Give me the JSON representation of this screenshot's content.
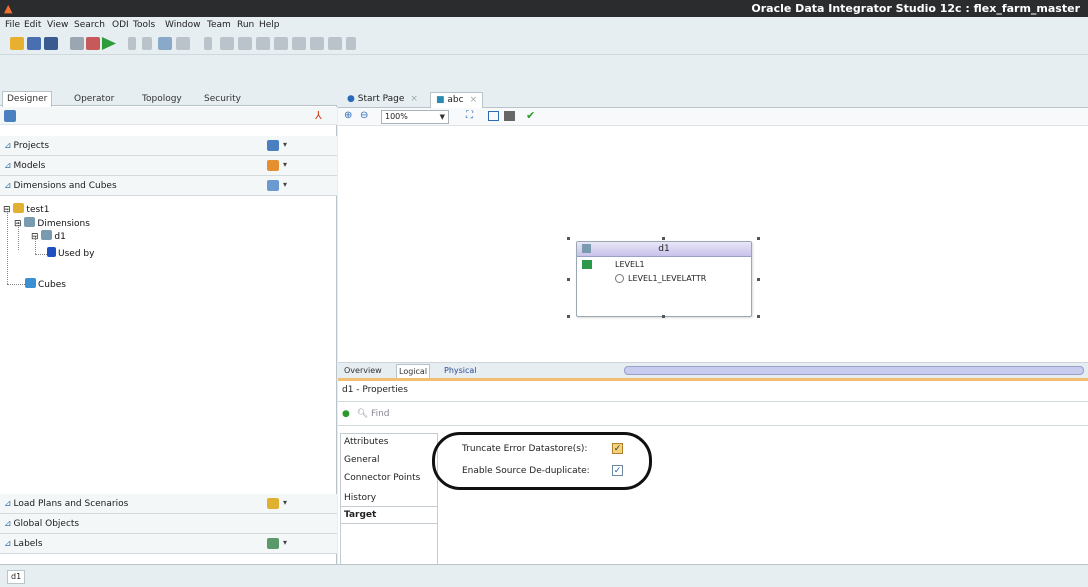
{
  "window": {
    "title": "Oracle Data Integrator Studio 12c : flex_farm_master"
  },
  "menu": [
    "File",
    "Edit",
    "View",
    "Search",
    "ODI",
    "Tools",
    "Window",
    "Team",
    "Run",
    "Help"
  ],
  "left_panel": {
    "tabs": [
      "Designer",
      "Operator",
      "Topology",
      "Security"
    ],
    "accordions": {
      "projects": "Projects",
      "models": "Models",
      "dimensions_cubes": "Dimensions and Cubes",
      "load_plans": "Load Plans and Scenarios",
      "global_objects": "Global Objects",
      "labels": "Labels"
    },
    "tree": {
      "root": "test1",
      "dimensions": "Dimensions",
      "d1": "d1",
      "used_by": "Used by",
      "cubes": "Cubes"
    }
  },
  "editor": {
    "tabs": [
      "Start Page",
      "abc"
    ],
    "zoom": "100%",
    "entity": {
      "name": "d1",
      "rows": [
        "LEVEL1",
        "LEVEL1_LEVELATTR"
      ]
    },
    "subtabs": [
      "Overview",
      "Logical",
      "Physical"
    ]
  },
  "properties": {
    "title": "d1 - Properties",
    "find_placeholder": "Find",
    "sections": [
      "Attributes",
      "General",
      "Connector Points",
      "History",
      "Target"
    ],
    "options": [
      {
        "label": "Truncate Error Datastore(s):",
        "checked": true
      },
      {
        "label": "Enable Source De-duplicate:",
        "checked": true
      }
    ]
  },
  "status": {
    "tab": "d1"
  },
  "colors": {
    "titlebar": "#2a2c2e",
    "chrome": "#e6eef2",
    "entity_header": "#c8c2ec",
    "accent_orange": "#f0c070"
  }
}
